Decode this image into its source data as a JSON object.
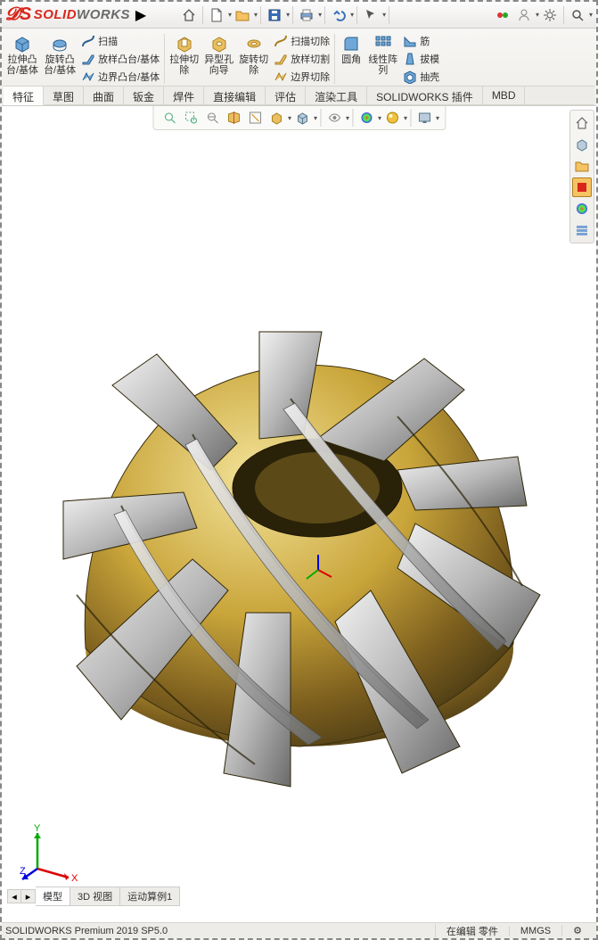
{
  "app_name": {
    "solid": "SOLID",
    "works": "WORKS"
  },
  "ribbon": {
    "extrude": "拉伸凸\n台/基体",
    "revolve": "旋转凸\n台/基体",
    "sweep": "扫描",
    "loft": "放样凸台/基体",
    "boundary": "边界凸台/基体",
    "cut_extrude": "拉伸切\n除",
    "hole_wizard": "异型孔\n向导",
    "cut_revolve": "旋转切\n除",
    "cut_sweep": "扫描切除",
    "cut_loft": "放样切割",
    "cut_boundary": "边界切除",
    "fillet": "圆角",
    "linear_pattern": "线性阵\n列",
    "rib": "筋",
    "draft": "拔模",
    "shell": "抽壳"
  },
  "tabs": [
    "特征",
    "草图",
    "曲面",
    "钣金",
    "焊件",
    "直接编辑",
    "评估",
    "渲染工具",
    "SOLIDWORKS 插件",
    "MBD"
  ],
  "active_tab": 0,
  "bottom_tabs": [
    "模型",
    "3D 视图",
    "运动算例1"
  ],
  "active_bottom_tab": 0,
  "status": {
    "product": "SOLIDWORKS Premium 2019 SP5.0",
    "edit_state": "在编辑 零件",
    "units": "MMGS"
  },
  "triad": {
    "x": "X",
    "y": "Y",
    "z": "Z"
  }
}
